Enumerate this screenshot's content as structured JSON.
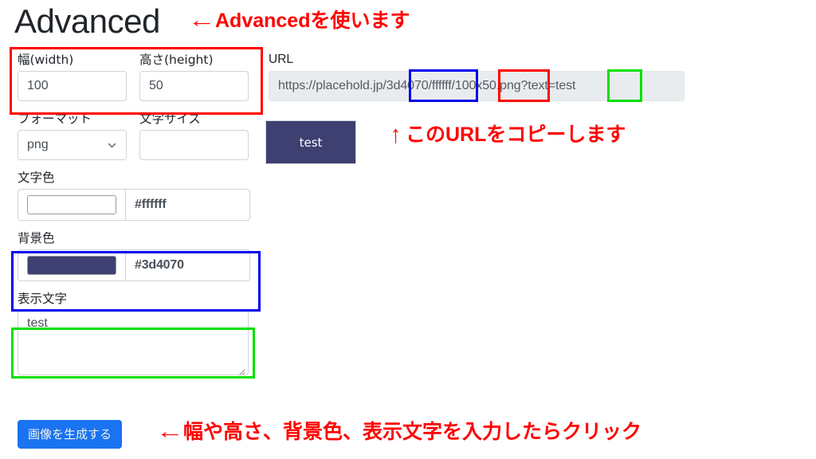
{
  "page": {
    "title": "Advanced"
  },
  "annotations": {
    "title_note": "Advancedを使います",
    "url_note": "このURLをコピーします",
    "button_note": "幅や高さ、背景色、表示文字を入力したらクリック",
    "arrow_left": "←",
    "arrow_up": "↑",
    "color": "#ff0000"
  },
  "form": {
    "width": {
      "label": "幅(width)",
      "value": "100",
      "placeholder": ""
    },
    "height": {
      "label": "高さ(height)",
      "value": "50",
      "placeholder": ""
    },
    "format": {
      "label": "フォーマット",
      "value": "png",
      "options": [
        "png"
      ],
      "icon": "chevron-down-icon"
    },
    "font_size": {
      "label": "文字サイズ",
      "value": "",
      "placeholder": ""
    },
    "text_color": {
      "label": "文字色",
      "hex": "#ffffff",
      "swatch": "#ffffff"
    },
    "bg_color": {
      "label": "背景色",
      "hex": "#3d4070",
      "swatch": "#3d4070"
    },
    "display_text": {
      "label": "表示文字",
      "value": "test",
      "placeholder": ""
    },
    "submit": {
      "label": "画像を生成する",
      "color": "#1a73f0"
    }
  },
  "url_panel": {
    "label": "URL",
    "full_value": "https://placehold.jp/3d4070/ffffff/100x50.png?text=test",
    "segments": {
      "base": "https://placehold.jp/",
      "bgcolor": "3d4070/",
      "textcolor": "ffffff/",
      "size": "100x50",
      "ext": ".png?text",
      "text": "=test"
    }
  },
  "preview": {
    "text": "test",
    "bg": "#3d4070",
    "fg": "#ffffff",
    "width": "100",
    "height": "50"
  },
  "highlights": {
    "size_box": "#ff0000",
    "bgcolor_box": "#0000ee",
    "text_box": "#00e000",
    "url_bgcolor": "#0000ee",
    "url_size": "#ff0000",
    "url_text": "#00e000"
  }
}
